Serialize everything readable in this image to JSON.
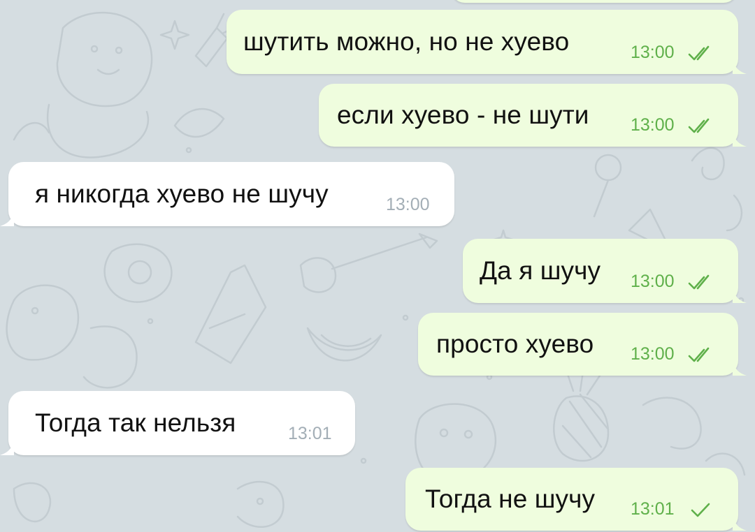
{
  "chat": {
    "wallpaper_color": "#d5dde1",
    "outgoing_bubble_color": "#effdde",
    "incoming_bubble_color": "#ffffff",
    "time_color_outgoing": "#5fb04a",
    "time_color_incoming": "#a3aeb6",
    "messages": [
      {
        "direction": "out",
        "text": "шутить можно, но не хуево",
        "time": "13:00",
        "status": "read-double-check-icon"
      },
      {
        "direction": "out",
        "text": "если хуево - не шути",
        "time": "13:00",
        "status": "read-double-check-icon"
      },
      {
        "direction": "in",
        "text": "я никогда хуево не шучу",
        "time": "13:00"
      },
      {
        "direction": "out",
        "text": "Да я шучу",
        "time": "13:00",
        "status": "read-double-check-icon"
      },
      {
        "direction": "out",
        "text": "просто хуево",
        "time": "13:00",
        "status": "read-double-check-icon"
      },
      {
        "direction": "in",
        "text": "Тогда так нельзя",
        "time": "13:01"
      },
      {
        "direction": "out",
        "text": "Тогда не шучу",
        "time": "13:01",
        "status": "sent-single-check-icon"
      }
    ]
  }
}
